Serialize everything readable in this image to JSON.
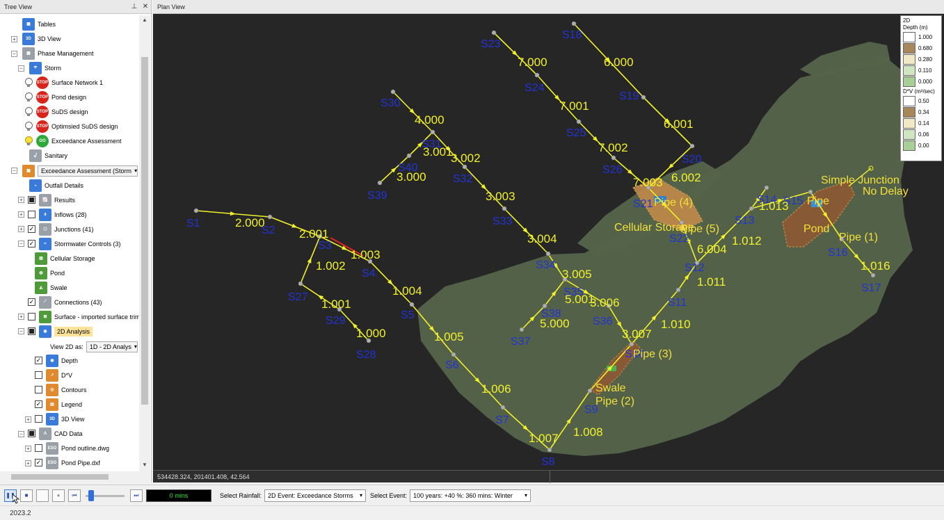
{
  "tree_panel": {
    "title": "Tree View",
    "pin_icon": "pin-icon",
    "close_icon": "close-icon",
    "items": [
      {
        "label": "Tables",
        "icon": "table-icon"
      },
      {
        "label": "3D View",
        "icon": "3d-view-icon"
      },
      {
        "label": "Phase Management",
        "icon": "phase-icon"
      },
      {
        "label": "Storm",
        "icon": "storm-icon"
      },
      {
        "label": "Surface Network 1",
        "icon": "stop-icon",
        "badge": "STOP"
      },
      {
        "label": "Pond design",
        "icon": "stop-icon",
        "badge": "STOP"
      },
      {
        "label": "SuDS design",
        "icon": "stop-icon",
        "badge": "STOP"
      },
      {
        "label": "Optimsied SuDS design",
        "icon": "stop-icon",
        "badge": "STOP"
      },
      {
        "label": "Exceedance Assessment",
        "icon": "go-icon",
        "badge": "GO"
      },
      {
        "label": "Sanitary",
        "icon": "sanitary-icon"
      },
      {
        "label": "Exceedance Assessment (Storm",
        "icon": "phase-icon"
      },
      {
        "label": "Outfall Details",
        "icon": "outfall-icon"
      },
      {
        "label": "Results",
        "icon": "results-icon"
      },
      {
        "label": "Inflows (28)",
        "icon": "inflows-icon"
      },
      {
        "label": "Junctions (41)",
        "icon": "junctions-icon"
      },
      {
        "label": "Stormwater Controls (3)",
        "icon": "controls-icon"
      },
      {
        "label": "Cellular Storage",
        "icon": "cellular-icon"
      },
      {
        "label": "Pond",
        "icon": "pond-icon"
      },
      {
        "label": "Swale",
        "icon": "swale-icon"
      },
      {
        "label": "Connections (43)",
        "icon": "connections-icon"
      },
      {
        "label": "Surface - imported surface trimr",
        "icon": "surface-icon"
      },
      {
        "label": "2D Analysis",
        "icon": "analysis-icon"
      },
      {
        "label": "View 2D as:",
        "icon": ""
      },
      {
        "label": "Depth",
        "icon": "depth-icon"
      },
      {
        "label": "D*V",
        "icon": "dv-icon"
      },
      {
        "label": "Contours",
        "icon": "contours-icon"
      },
      {
        "label": "Legend",
        "icon": "legend-icon"
      },
      {
        "label": "3D View",
        "icon": "3d-view-icon"
      },
      {
        "label": "CAD Data",
        "icon": "cad-icon"
      },
      {
        "label": "Pond outline.dwg",
        "icon": "file-icon",
        "badge": "ESO"
      },
      {
        "label": "Pond Pipe.dxf",
        "icon": "file-icon",
        "badge": "ESO"
      }
    ],
    "view_2d_value": "1D - 2D Analys"
  },
  "plan_panel": {
    "title": "Plan View",
    "coordinates": "534428.324, 201401.408, 42.564"
  },
  "map": {
    "background_color": "#262626",
    "terrain_color": "#55644a",
    "pipe_color": "#f2f22a",
    "node_color": "#2233d6",
    "nodes": [
      "S1",
      "S2",
      "S3",
      "S4",
      "S5",
      "S6",
      "S7",
      "S8",
      "S9",
      "S10",
      "S11",
      "S12",
      "S13",
      "S14",
      "S15",
      "S16",
      "S17",
      "S18",
      "S19",
      "S20",
      "S21",
      "S22",
      "S23",
      "S24",
      "S25",
      "S26",
      "S27",
      "S28",
      "S29",
      "S30",
      "S31",
      "S32",
      "S33",
      "S34",
      "S35",
      "S36",
      "S37",
      "S38",
      "S39",
      "S40"
    ],
    "pipes": [
      "2.000",
      "2.001",
      "1.003",
      "1.002",
      "1.004",
      "1.001",
      "1.000",
      "1.005",
      "1.006",
      "1.007",
      "1.008",
      "3.000",
      "3.001",
      "3.002",
      "3.003",
      "3.004",
      "3.005",
      "3.006",
      "3.007",
      "4.000",
      "5.000",
      "5.001",
      "6.000",
      "6.001",
      "6.002",
      "7.000",
      "7.001",
      "7.002",
      "7.003",
      "6.004",
      "1.010",
      "1.011",
      "1.012",
      "1.013",
      "1.016"
    ],
    "controls": [
      "Cellular Storage",
      "Pond",
      "Swale",
      "Pipe (1)",
      "Pipe (2)",
      "Pipe (3)",
      "Pipe (4)",
      "Pipe (5)",
      "Pipe",
      "Simple Junction",
      "No Delay"
    ]
  },
  "legend": {
    "title": "2D",
    "depth_title": "Depth (m)",
    "depth": [
      {
        "value": "1.000",
        "color": "#ffffff"
      },
      {
        "value": "0.680",
        "color": "#a8875a"
      },
      {
        "value": "0.280",
        "color": "#f1e9c5"
      },
      {
        "value": "0.110",
        "color": "#cfe6c0"
      },
      {
        "value": "0.000",
        "color": "#a8cf96"
      }
    ],
    "dv_title": "D*V (m²/sec)",
    "dv": [
      {
        "value": "0.50",
        "color": "#ffffff"
      },
      {
        "value": "0.34",
        "color": "#a8875a"
      },
      {
        "value": "0.14",
        "color": "#f1e9c5"
      },
      {
        "value": "0.06",
        "color": "#cfe6c0"
      },
      {
        "value": "0.00",
        "color": "#a8cf96"
      }
    ]
  },
  "toolbar": {
    "time": "0 mins",
    "rainfall_label": "Select Rainfall:",
    "rainfall_value": "2D Event: Exceedance Storms",
    "event_label": "Select Event:",
    "event_value": "100 years: +40 %: 360 mins: Winter"
  },
  "status": {
    "version": "2023.2"
  }
}
